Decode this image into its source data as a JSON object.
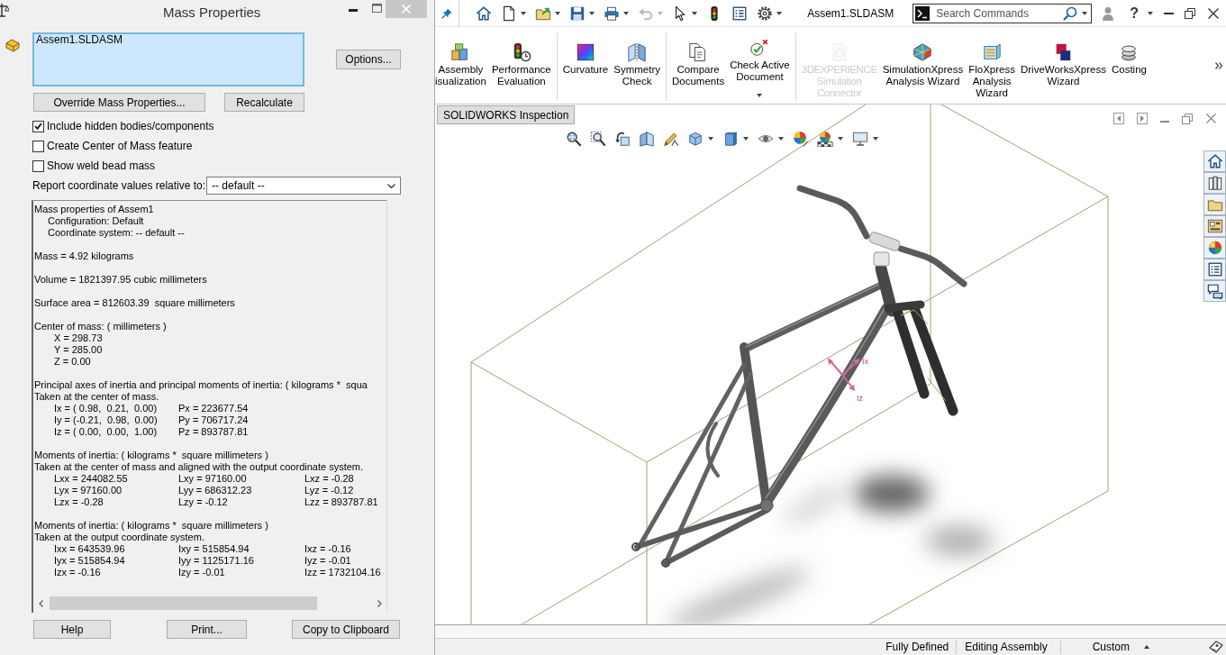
{
  "mass_properties_dialog": {
    "title": "Mass Properties",
    "selection_list": [
      "Assem1.SLDASM"
    ],
    "options_button": "Options...",
    "buttons": [
      "Override Mass Properties...",
      "Recalculate"
    ],
    "checkboxes": [
      {
        "label": "Include hidden bodies/components",
        "checked": true
      },
      {
        "label": "Create Center of Mass feature",
        "checked": false
      },
      {
        "label": "Show weld bead mass",
        "checked": false
      }
    ],
    "coordinate_system": {
      "label": "Report coordinate values relative to:",
      "value": "-- default --"
    },
    "results": [
      {
        "lines": [
          {
            "kind": "plain",
            "text": "Mass properties of Assem1"
          },
          {
            "kind": "indent",
            "text": "Configuration: Default"
          },
          {
            "kind": "indent",
            "text": "Coordinate system: -- default --"
          }
        ]
      },
      {
        "lines": [
          {
            "kind": "plain",
            "text": "Mass = 4.92 kilograms"
          }
        ]
      },
      {
        "lines": [
          {
            "kind": "plain",
            "text": "Volume = 1821397.95 cubic millimeters"
          }
        ]
      },
      {
        "lines": [
          {
            "kind": "plain",
            "text": "Surface area = 812603.39  square millimeters"
          }
        ]
      },
      {
        "lines": [
          {
            "kind": "plain",
            "text": "Center of mass: ( millimeters )"
          },
          {
            "kind": "values",
            "cells": [
              "X = 298.73"
            ]
          },
          {
            "kind": "values",
            "cells": [
              "Y = 285.00"
            ]
          },
          {
            "kind": "values",
            "cells": [
              "Z = 0.00"
            ]
          }
        ]
      },
      {
        "lines": [
          {
            "kind": "plain",
            "text": "Principal axes of inertia and principal moments of inertia: ( kilograms *  squa"
          },
          {
            "kind": "plain",
            "text": "Taken at the center of mass."
          },
          {
            "kind": "values",
            "cells": [
              "Ix = ( 0.98,  0.21,  0.00)",
              "Px = 223677.54"
            ]
          },
          {
            "kind": "values",
            "cells": [
              "Iy = (-0.21,  0.98,  0.00)",
              "Py = 706717.24"
            ]
          },
          {
            "kind": "values",
            "cells": [
              "Iz = ( 0.00,  0.00,  1.00)",
              "Pz = 893787.81"
            ]
          }
        ]
      },
      {
        "lines": [
          {
            "kind": "plain",
            "text": "Moments of inertia: ( kilograms *  square millimeters )"
          },
          {
            "kind": "plain",
            "text": "Taken at the center of mass and aligned with the output coordinate system."
          },
          {
            "kind": "values",
            "cells": [
              "Lxx = 244082.55",
              "Lxy = 97160.00",
              "Lxz = -0.28"
            ]
          },
          {
            "kind": "values",
            "cells": [
              "Lyx = 97160.00",
              "Lyy = 686312.23",
              "Lyz = -0.12"
            ]
          },
          {
            "kind": "values",
            "cells": [
              "Lzx = -0.28",
              "Lzy = -0.12",
              "Lzz = 893787.81"
            ]
          }
        ]
      },
      {
        "lines": [
          {
            "kind": "plain",
            "text": "Moments of inertia: ( kilograms *  square millimeters )"
          },
          {
            "kind": "plain",
            "text": "Taken at the output coordinate system."
          },
          {
            "kind": "values",
            "cells": [
              "Ixx = 643539.96",
              "Ixy = 515854.94",
              "Ixz = -0.16"
            ]
          },
          {
            "kind": "values",
            "cells": [
              "Iyx = 515854.94",
              "Iyy = 1125171.16",
              "Iyz = -0.01"
            ]
          },
          {
            "kind": "values",
            "cells": [
              "Izx = -0.16",
              "Izy = -0.01",
              "Izz = 1732104.16"
            ]
          }
        ]
      }
    ],
    "footer_buttons": [
      "Help",
      "Print...",
      "Copy to Clipboard"
    ]
  },
  "solidworks_window": {
    "quick_access": [
      {
        "kind": "home",
        "dropdown": false,
        "disabled": false
      },
      {
        "kind": "new-document",
        "dropdown": true,
        "disabled": false
      },
      {
        "kind": "open",
        "dropdown": true,
        "disabled": false
      },
      {
        "kind": "save",
        "dropdown": true,
        "disabled": false
      },
      {
        "kind": "print",
        "dropdown": true,
        "disabled": false
      },
      {
        "kind": "undo",
        "dropdown": true,
        "disabled": true
      },
      {
        "kind": "select",
        "dropdown": true,
        "disabled": false
      },
      {
        "kind": "rebuild",
        "dropdown": false,
        "disabled": false
      },
      {
        "kind": "file-properties",
        "dropdown": false,
        "disabled": false
      },
      {
        "kind": "options",
        "dropdown": true,
        "disabled": false
      }
    ],
    "document_title": "Assem1.SLDASM",
    "search": {
      "placeholder": "Search Commands"
    },
    "help_button": "?",
    "ribbon_groups": [
      {
        "items": [
          {
            "kind": "assembly-visualization",
            "lines": [
              "Assembly",
              "isualization"
            ],
            "disabled": false,
            "dropdown": false
          },
          {
            "kind": "performance-evaluation",
            "lines": [
              "Performance",
              "Evaluation"
            ],
            "disabled": false,
            "dropdown": false
          }
        ]
      },
      {
        "items": [
          {
            "kind": "curvature",
            "lines": [
              "Curvature"
            ],
            "disabled": false,
            "dropdown": false
          },
          {
            "kind": "symmetry-check",
            "lines": [
              "Symmetry",
              "Check"
            ],
            "disabled": false,
            "dropdown": false
          }
        ]
      },
      {
        "items": [
          {
            "kind": "compare-documents",
            "lines": [
              "Compare",
              "Documents"
            ],
            "disabled": false,
            "dropdown": false
          },
          {
            "kind": "check-active-document",
            "lines": [
              "Check Active",
              "Document"
            ],
            "disabled": false,
            "dropdown": true
          }
        ]
      },
      {
        "items": [
          {
            "kind": "simulation-connector",
            "lines": [
              "3DEXPERIENCE",
              "Simulation",
              "Connector"
            ],
            "disabled": true,
            "dropdown": false
          },
          {
            "kind": "simulationxpress",
            "lines": [
              "SimulationXpress",
              "Analysis Wizard"
            ],
            "disabled": false,
            "dropdown": false
          },
          {
            "kind": "floxpress",
            "lines": [
              "FloXpress",
              "Analysis",
              "Wizard"
            ],
            "disabled": false,
            "dropdown": false
          },
          {
            "kind": "driveworksxpress",
            "lines": [
              "DriveWorksXpress",
              "Wizard"
            ],
            "disabled": false,
            "dropdown": false
          },
          {
            "kind": "costing",
            "lines": [
              "Costing"
            ],
            "disabled": false,
            "dropdown": false
          }
        ]
      }
    ],
    "tabs": [
      {
        "label": "SOLIDWORKS Inspection",
        "selected": false
      }
    ],
    "view_toolbar": [
      {
        "kind": "zoom-to-fit",
        "dropdown": false
      },
      {
        "kind": "zoom-to-area",
        "dropdown": false
      },
      {
        "kind": "previous-view",
        "dropdown": false
      },
      {
        "kind": "section-view",
        "dropdown": false
      },
      {
        "kind": "dynamic-annotation",
        "dropdown": false
      },
      {
        "kind": "view-orientation",
        "dropdown": true
      },
      {
        "kind": "display-style",
        "dropdown": true
      },
      {
        "kind": "hide-show",
        "dropdown": true
      },
      {
        "kind": "edit-appearance",
        "dropdown": false
      },
      {
        "kind": "apply-scene",
        "dropdown": true
      },
      {
        "kind": "view-setting",
        "dropdown": true
      }
    ],
    "task_pane": [
      {
        "kind": "home"
      },
      {
        "kind": "design-library"
      },
      {
        "kind": "file-explorer"
      },
      {
        "kind": "view-palette"
      },
      {
        "kind": "appearances"
      },
      {
        "kind": "custom-properties"
      },
      {
        "kind": "forum"
      }
    ],
    "viewport": {
      "axis_labels": [
        "Ix",
        "Iz"
      ]
    },
    "status_bar": {
      "items": [
        "Fully Defined",
        "Editing Assembly"
      ],
      "units": "Custom"
    }
  }
}
